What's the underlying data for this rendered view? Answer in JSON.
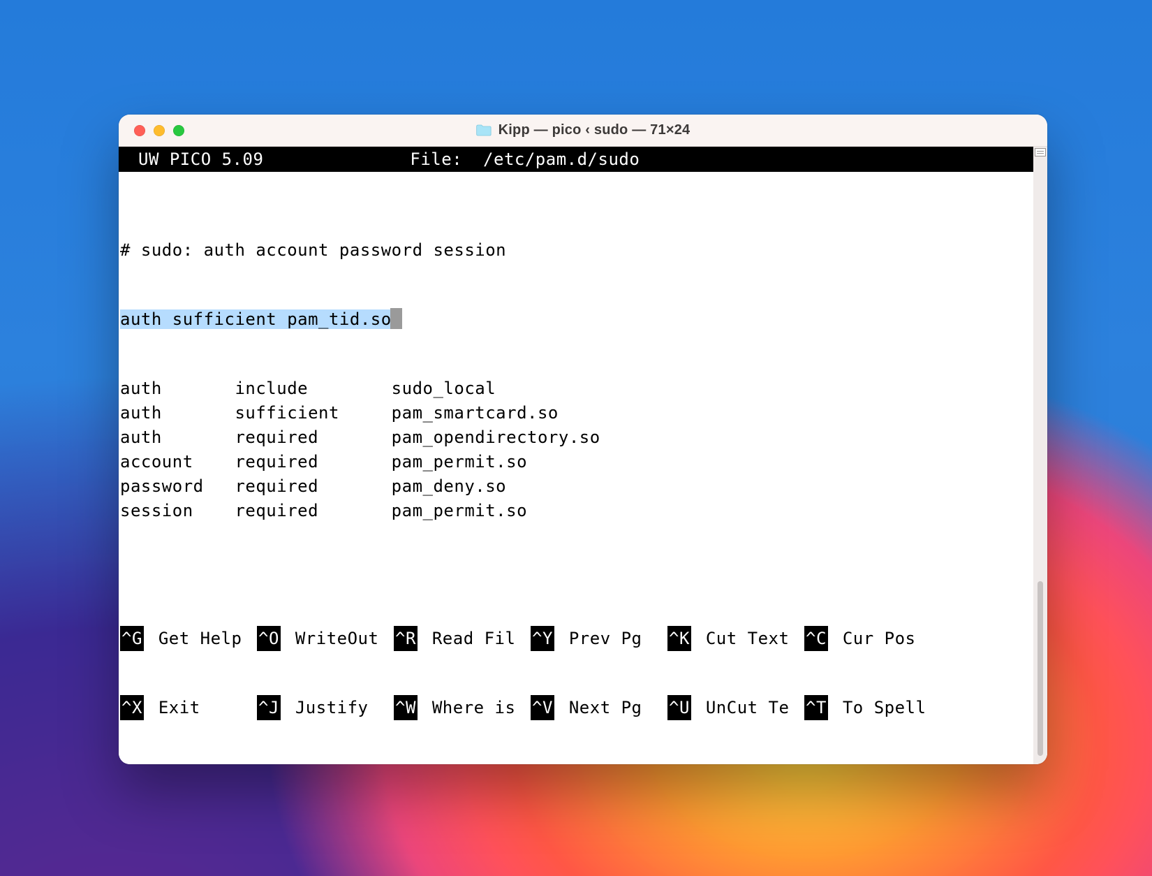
{
  "window": {
    "title": "Kipp — pico ‹ sudo — 71×24",
    "traffic": {
      "close": "#ff5f57",
      "min": "#febc2e",
      "zoom": "#28c840"
    }
  },
  "editor": {
    "app_name": "UW PICO 5.09",
    "file_label": "File:",
    "file_path": "/etc/pam.d/sudo",
    "selected_line": "auth sufficient pam_tid.so",
    "comment_line": "# sudo: auth account password session",
    "rows": [
      {
        "c1": "auth",
        "c2": "include",
        "c3": "sudo_local"
      },
      {
        "c1": "auth",
        "c2": "sufficient",
        "c3": "pam_smartcard.so"
      },
      {
        "c1": "auth",
        "c2": "required",
        "c3": "pam_opendirectory.so"
      },
      {
        "c1": "account",
        "c2": "required",
        "c3": "pam_permit.so"
      },
      {
        "c1": "password",
        "c2": "required",
        "c3": "pam_deny.so"
      },
      {
        "c1": "session",
        "c2": "required",
        "c3": "pam_permit.so"
      }
    ]
  },
  "shortcuts": {
    "row1": [
      {
        "k": "^G",
        "l": "Get Help"
      },
      {
        "k": "^O",
        "l": "WriteOut"
      },
      {
        "k": "^R",
        "l": "Read Fil"
      },
      {
        "k": "^Y",
        "l": "Prev Pg"
      },
      {
        "k": "^K",
        "l": "Cut Text"
      },
      {
        "k": "^C",
        "l": "Cur Pos"
      }
    ],
    "row2": [
      {
        "k": "^X",
        "l": "Exit"
      },
      {
        "k": "^J",
        "l": "Justify"
      },
      {
        "k": "^W",
        "l": "Where is"
      },
      {
        "k": "^V",
        "l": "Next Pg"
      },
      {
        "k": "^U",
        "l": "UnCut Te"
      },
      {
        "k": "^T",
        "l": "To Spell"
      }
    ]
  }
}
